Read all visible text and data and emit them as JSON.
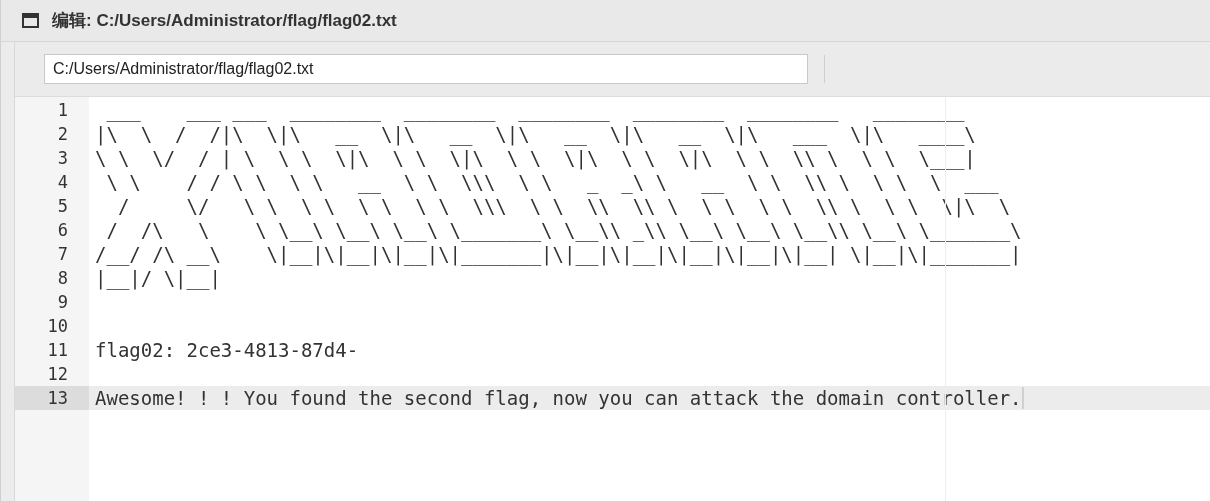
{
  "window": {
    "title": "编辑: C:/Users/Administrator/flag/flag02.txt"
  },
  "path_field": {
    "value": "C:/Users/Administrator/flag/flag02.txt"
  },
  "editor": {
    "lines": [
      {
        "number": "1",
        "text": " ___    ___ ___  ________  ________  ________  ________  ________   ________",
        "selected": false
      },
      {
        "number": "2",
        "text": "|\\  \\  /  /|\\  \\|\\   __  \\|\\   __  \\|\\   __  \\|\\   __  \\|\\   ___  \\|\\   ____\\",
        "selected": false
      },
      {
        "number": "3",
        "text": "\\ \\  \\/  / | \\  \\ \\  \\|\\  \\ \\  \\|\\  \\ \\  \\|\\  \\ \\  \\|\\  \\ \\  \\\\ \\  \\ \\  \\___|",
        "selected": false
      },
      {
        "number": "4",
        "text": " \\ \\    / / \\ \\  \\ \\   __  \\ \\  \\\\\\  \\ \\   _  _\\ \\   __  \\ \\  \\\\ \\  \\ \\  \\  ___",
        "selected": false
      },
      {
        "number": "5",
        "text": "  /     \\/   \\ \\  \\ \\  \\ \\  \\ \\  \\\\\\  \\ \\  \\\\  \\\\ \\  \\ \\  \\ \\  \\\\ \\  \\ \\  \\|\\  \\",
        "selected": false
      },
      {
        "number": "6",
        "text": " /  /\\   \\    \\ \\__\\ \\__\\ \\__\\ \\_______\\ \\__\\\\ _\\\\ \\__\\ \\__\\ \\__\\\\ \\__\\ \\_______\\",
        "selected": false
      },
      {
        "number": "7",
        "text": "/__/ /\\ __\\    \\|__|\\|__|\\|__|\\|_______|\\|__|\\|__|\\|__|\\|__|\\|__| \\|__|\\|_______|",
        "selected": false
      },
      {
        "number": "8",
        "text": "|__|/ \\|__|",
        "selected": false
      },
      {
        "number": "9",
        "selected": false
      },
      {
        "number": "10",
        "selected": false
      },
      {
        "number": "11",
        "text": "flag02: 2ce3-4813-87d4-",
        "selected": false
      },
      {
        "number": "12",
        "selected": false
      },
      {
        "number": "13",
        "text": "Awesome! ! ! You found the second flag, now you can attack the domain controller.",
        "selected": true
      }
    ]
  }
}
